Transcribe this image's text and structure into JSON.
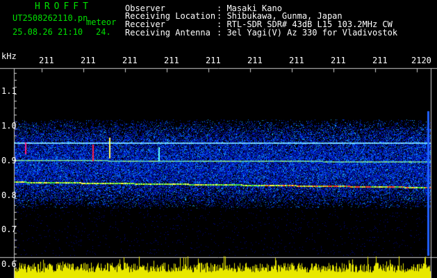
{
  "header": {
    "app_title": "HROFFT",
    "file_name": "UT2508262110.pn",
    "mode": "meteor",
    "datetime": "25.08.26 21:10",
    "extra": "24.",
    "fields": [
      {
        "label": "Observer",
        "value": ": Masaki Kano"
      },
      {
        "label": "Receiving Location",
        "value": ": Shibukawa, Gunma, Japan"
      },
      {
        "label": "Receiver",
        "value": ": RTL-SDR SDR# 43dB L15 103.2MHz CW"
      },
      {
        "label": "Receiving Antenna",
        "value": ": 3el Yagi(V) Az 330 for Vladivostok"
      }
    ]
  },
  "axis": {
    "unit": "kHz",
    "time_ticks": [
      "211",
      "211",
      "211",
      "211",
      "211",
      "211",
      "211",
      "211",
      "211",
      "2120"
    ],
    "freq_ticks": [
      "1.1",
      "1.0",
      "0.9",
      "0.8",
      "0.7",
      "0.6"
    ]
  },
  "colors": {
    "label": "#00e000",
    "text": "#ffffff",
    "background": "#000000",
    "noise": "#0018c8",
    "signal": "#ffff00"
  }
}
